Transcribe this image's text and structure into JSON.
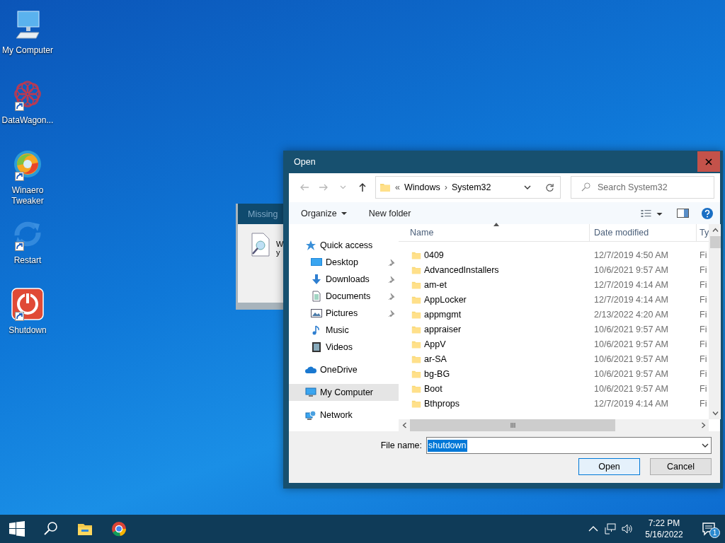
{
  "desktop_icons": [
    {
      "label": "My Computer",
      "kind": "computer",
      "shortcut": false
    },
    {
      "label": "DataWagon...",
      "kind": "datawagon",
      "shortcut": true
    },
    {
      "label": "Winaero Tweaker",
      "kind": "swirl",
      "shortcut": true
    },
    {
      "label": "Restart",
      "kind": "restart",
      "shortcut": true
    },
    {
      "label": "Shutdown",
      "kind": "power",
      "shortcut": true
    }
  ],
  "background_window": {
    "title": "Missing",
    "lines": [
      "W",
      "y"
    ]
  },
  "open_dialog": {
    "title": "Open",
    "nav_buttons": [
      {
        "kind": "back",
        "disabled": true
      },
      {
        "kind": "forward",
        "disabled": true
      },
      {
        "kind": "recent",
        "disabled": true
      },
      {
        "kind": "up",
        "disabled": false
      }
    ],
    "address": {
      "overflow": "«",
      "path": [
        "Windows",
        "System32"
      ],
      "separator": "›"
    },
    "search": {
      "placeholder": "Search System32"
    },
    "toolbar": [
      {
        "label": "Organize",
        "dropdown": true
      },
      {
        "label": "New folder",
        "dropdown": false
      }
    ],
    "sidebar": [
      {
        "label": "Quick access",
        "kind": "star",
        "selected": false,
        "children": [
          {
            "label": "Desktop",
            "kind": "desktop",
            "pinned": true,
            "selected": false
          },
          {
            "label": "Downloads",
            "kind": "download",
            "pinned": true,
            "selected": false
          },
          {
            "label": "Documents",
            "kind": "document",
            "pinned": true,
            "selected": false
          },
          {
            "label": "Pictures",
            "kind": "pictures",
            "pinned": true,
            "selected": false
          },
          {
            "label": "Music",
            "kind": "music",
            "pinned": false,
            "selected": false
          },
          {
            "label": "Videos",
            "kind": "videos",
            "pinned": false,
            "selected": false
          }
        ]
      },
      {
        "label": "OneDrive",
        "kind": "cloud",
        "selected": false
      },
      {
        "label": "My Computer",
        "kind": "computer",
        "selected": true
      },
      {
        "label": "Network",
        "kind": "network",
        "selected": false
      }
    ],
    "columns": [
      {
        "label": "Name",
        "sorted": true
      },
      {
        "label": "Date modified",
        "sorted": false
      },
      {
        "label": "Ty",
        "sorted": false
      }
    ],
    "rows": [
      {
        "name": "0409",
        "date": "12/7/2019 4:50 AM",
        "column_3": "Fi"
      },
      {
        "name": "AdvancedInstallers",
        "date": "10/6/2021 9:57 AM",
        "column_3": "Fi"
      },
      {
        "name": "am-et",
        "date": "12/7/2019 4:14 AM",
        "column_3": "Fi"
      },
      {
        "name": "AppLocker",
        "date": "12/7/2019 4:14 AM",
        "column_3": "Fi"
      },
      {
        "name": "appmgmt",
        "date": "2/13/2022 4:20 AM",
        "column_3": "Fi"
      },
      {
        "name": "appraiser",
        "date": "10/6/2021 9:57 AM",
        "column_3": "Fi"
      },
      {
        "name": "AppV",
        "date": "10/6/2021 9:57 AM",
        "column_3": "Fi"
      },
      {
        "name": "ar-SA",
        "date": "10/6/2021 9:57 AM",
        "column_3": "Fi"
      },
      {
        "name": "bg-BG",
        "date": "10/6/2021 9:57 AM",
        "column_3": "Fi"
      },
      {
        "name": "Boot",
        "date": "10/6/2021 9:57 AM",
        "column_3": "Fi"
      },
      {
        "name": "Bthprops",
        "date": "12/7/2019 4:14 AM",
        "column_3": "Fi"
      }
    ],
    "file_name": {
      "label": "File name:",
      "value": "shutdown",
      "selected": true
    },
    "buttons": [
      {
        "label": "Open",
        "default": true
      },
      {
        "label": "Cancel",
        "default": false
      }
    ]
  },
  "taskbar": {
    "pinned": [
      {
        "kind": "start"
      },
      {
        "kind": "search"
      },
      {
        "kind": "explorer"
      },
      {
        "kind": "chrome"
      }
    ],
    "time": "7:22 PM",
    "date": "5/16/2022",
    "notifications": "1"
  }
}
